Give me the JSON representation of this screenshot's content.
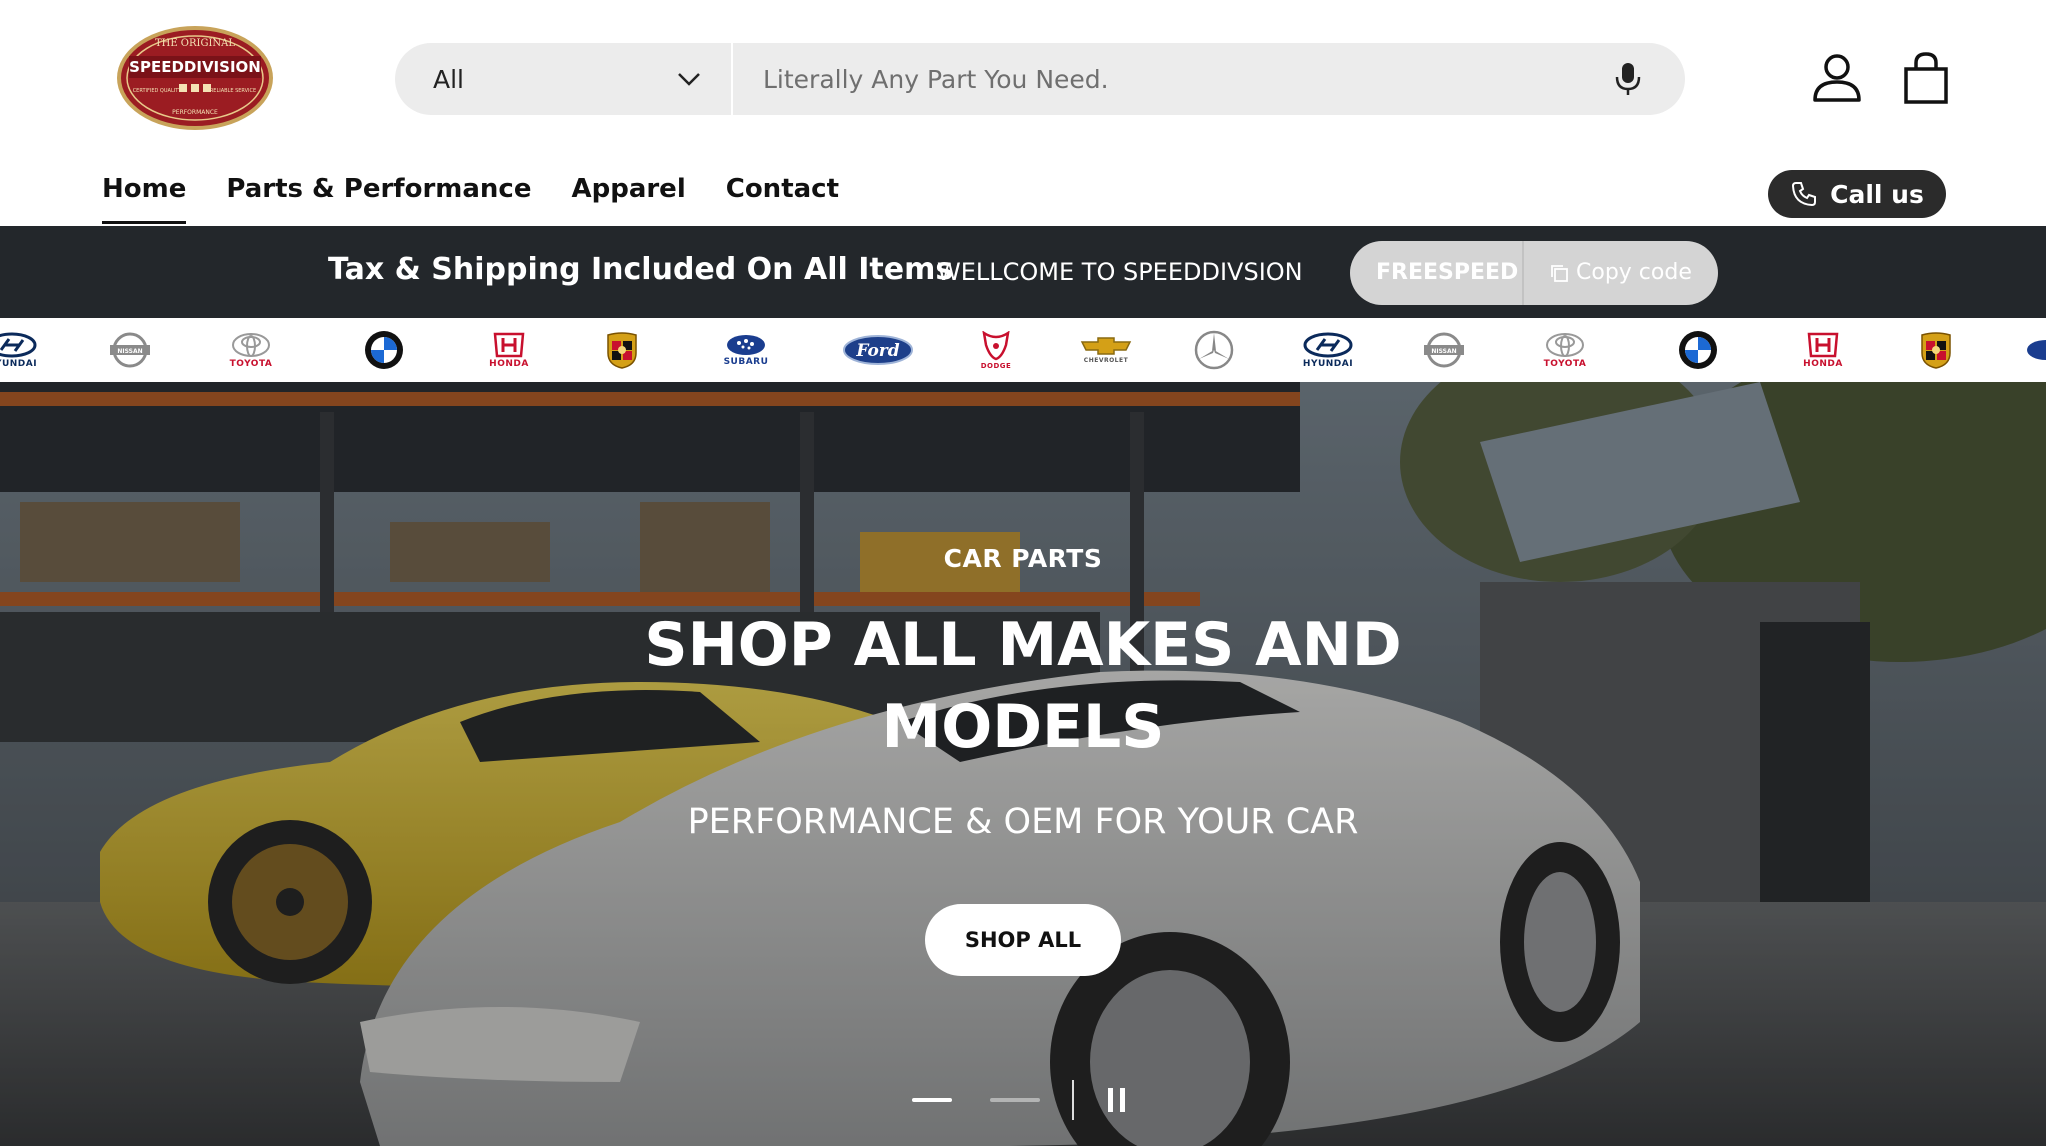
{
  "brand": {
    "logo_top": "THE ORIGINAL",
    "logo_name": "SPEEDDIVISION",
    "logo_left": "CERTIFIED QUALITY",
    "logo_right": "RELIABLE SERVICE",
    "logo_bottom": "PERFORMANCE"
  },
  "search": {
    "category": "All",
    "placeholder": "Literally Any Part You Need."
  },
  "nav": {
    "items": [
      {
        "label": "Home"
      },
      {
        "label": "Parts & Performance"
      },
      {
        "label": "Apparel"
      },
      {
        "label": "Contact"
      }
    ],
    "call_label": "Call us"
  },
  "announcement": {
    "main": "Tax & Shipping Included On All Items",
    "welcome": "WELLCOME TO SPEEDDIVSION",
    "code": "FREESPEED",
    "copy_label": "Copy code"
  },
  "brands": {
    "hyundai": "HYUNDAI",
    "nissan": "NISSAN",
    "toyota": "TOYOTA",
    "honda": "HONDA",
    "subaru": "SUBARU",
    "ford": "Ford",
    "dodge": "DODGE",
    "chevrolet": "CHEVROLET"
  },
  "hero": {
    "eyebrow": "CAR PARTS",
    "title": "SHOP ALL MAKES AND MODELS",
    "subtitle": "PERFORMANCE & OEM FOR YOUR CAR",
    "cta": "SHOP ALL"
  },
  "colors": {
    "announcement_bg": "#23272b",
    "call_button": "#2b2b2b",
    "logo_red": "#9b1c22",
    "search_bg": "#ececec"
  }
}
